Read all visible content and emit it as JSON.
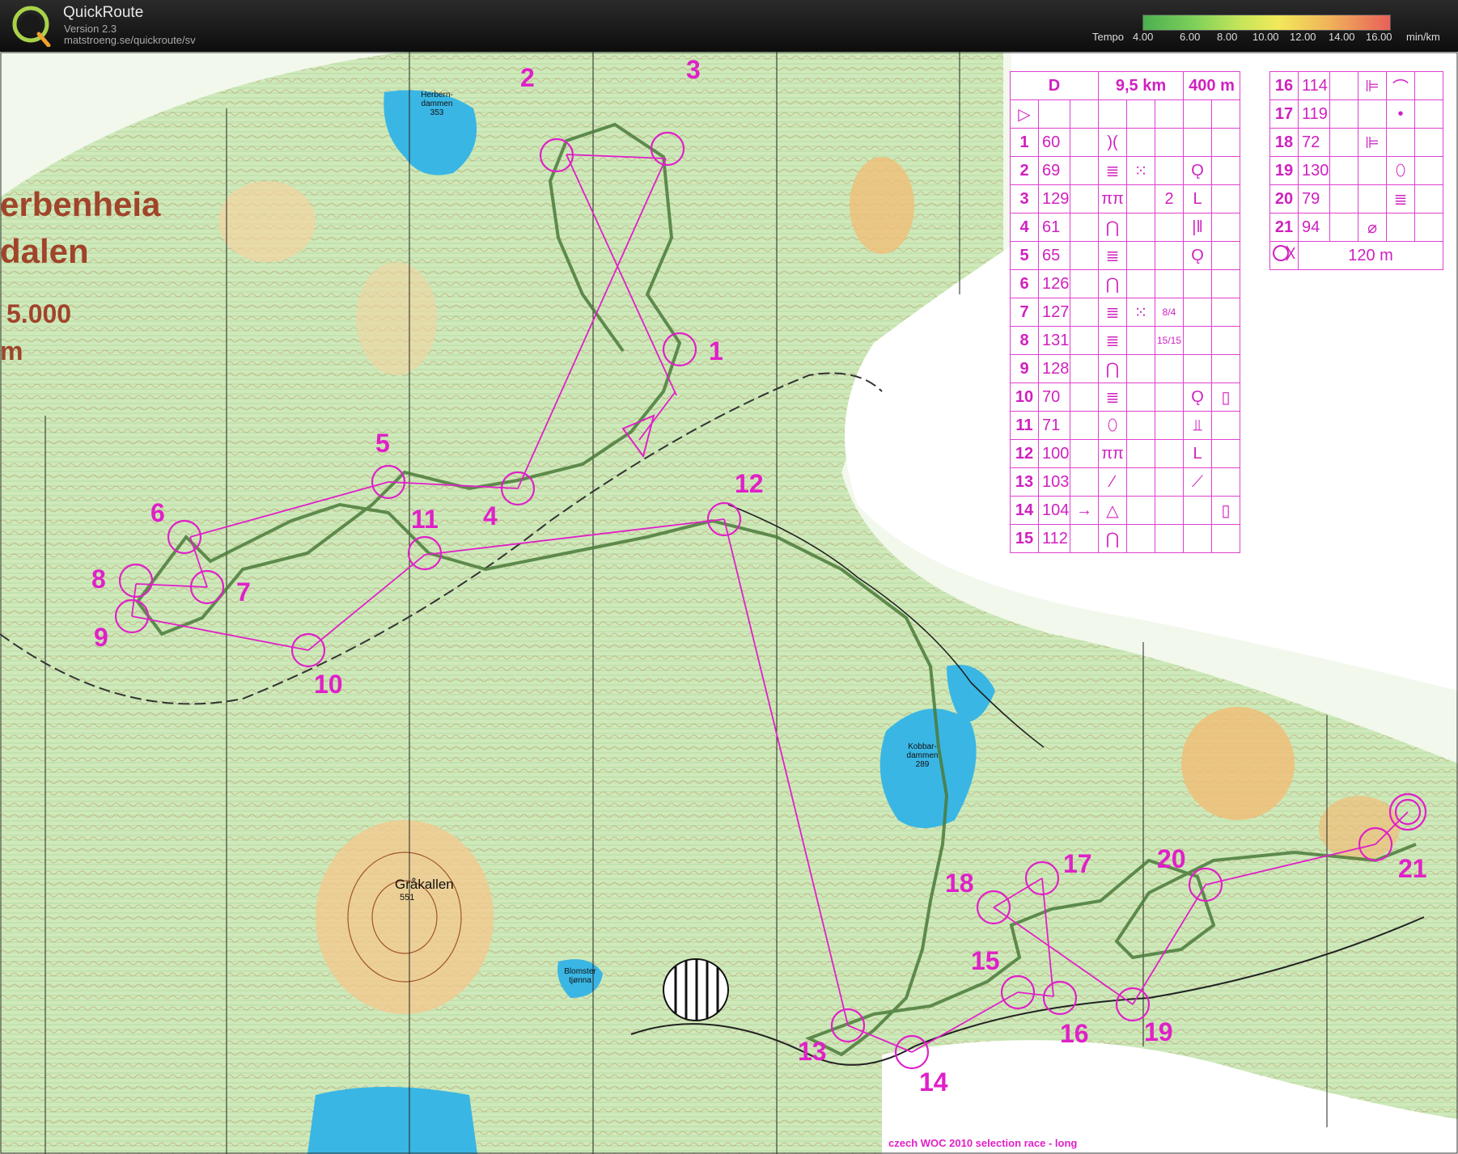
{
  "app": {
    "name": "QuickRoute",
    "version": "Version 2.3",
    "url": "matstroeng.se/quickroute/sv",
    "logo_letter": "Q"
  },
  "tempo": {
    "label": "Tempo",
    "ticks": [
      "4.00",
      "6.00",
      "8.00",
      "10.00",
      "12.00",
      "14.00",
      "16.00"
    ],
    "unit": "min/km"
  },
  "map": {
    "title_line1": "erbenheia",
    "title_line2": "dalen",
    "scale": "5.000",
    "scale_unit": "m",
    "footer": "czech WOC 2010 selection race - long",
    "places": [
      {
        "name": "Gråkallen",
        "height": "551"
      }
    ],
    "lakes": [
      {
        "name1": "Herbern-",
        "name2": "dammen",
        "height": "353"
      },
      {
        "name1": "Kobbar-",
        "name2": "dammen",
        "height": "289"
      },
      {
        "name1": "Blomster",
        "name2": "tjønna",
        "height": ""
      }
    ],
    "controls": [
      "1",
      "2",
      "3",
      "4",
      "5",
      "6",
      "7",
      "8",
      "9",
      "10",
      "11",
      "12",
      "13",
      "14",
      "15",
      "16",
      "17",
      "18",
      "19",
      "20",
      "21"
    ]
  },
  "description": {
    "header": {
      "class": "D",
      "length": "9,5 km",
      "climb": "400 m"
    },
    "start_symbol": "▷",
    "rows": [
      {
        "n": "1",
        "code": "60",
        "c": "",
        "d": ")(",
        "e": "",
        "f": "",
        "g": "",
        "h": ""
      },
      {
        "n": "2",
        "code": "69",
        "c": "",
        "d": "≣",
        "e": "⁙",
        "f": "",
        "g": "Ǫ",
        "h": ""
      },
      {
        "n": "3",
        "code": "129",
        "c": "",
        "d": "ππ",
        "e": "",
        "f": "2",
        "g": "L",
        "h": ""
      },
      {
        "n": "4",
        "code": "61",
        "c": "",
        "d": "⋂",
        "e": "",
        "f": "",
        "g": "|‖",
        "h": ""
      },
      {
        "n": "5",
        "code": "65",
        "c": "",
        "d": "≣",
        "e": "",
        "f": "",
        "g": "Ǫ",
        "h": ""
      },
      {
        "n": "6",
        "code": "126",
        "c": "",
        "d": "⋂",
        "e": "",
        "f": "",
        "g": "",
        "h": ""
      },
      {
        "n": "7",
        "code": "127",
        "c": "",
        "d": "≣",
        "e": "⁙",
        "f": "8/4",
        "g": "",
        "h": ""
      },
      {
        "n": "8",
        "code": "131",
        "c": "",
        "d": "≣",
        "e": "",
        "f": "15/15",
        "g": "",
        "h": ""
      },
      {
        "n": "9",
        "code": "128",
        "c": "",
        "d": "⋂",
        "e": "",
        "f": "",
        "g": "",
        "h": ""
      },
      {
        "n": "10",
        "code": "70",
        "c": "",
        "d": "≣",
        "e": "",
        "f": "",
        "g": "Ǫ",
        "h": "▯"
      },
      {
        "n": "11",
        "code": "71",
        "c": "",
        "d": "⬯",
        "e": "",
        "f": "",
        "g": "⫫",
        "h": ""
      },
      {
        "n": "12",
        "code": "100",
        "c": "",
        "d": "ππ",
        "e": "",
        "f": "",
        "g": "L",
        "h": ""
      },
      {
        "n": "13",
        "code": "103",
        "c": "",
        "d": "⁄",
        "e": "",
        "f": "",
        "g": "⟋",
        "h": ""
      },
      {
        "n": "14",
        "code": "104",
        "c": "→",
        "d": "△",
        "e": "",
        "f": "",
        "g": "",
        "h": "▯"
      },
      {
        "n": "15",
        "code": "112",
        "c": "",
        "d": "⋂",
        "e": "",
        "f": "",
        "g": "",
        "h": ""
      }
    ],
    "rows2": [
      {
        "n": "16",
        "code": "114",
        "d": "⊫",
        "e": "⌒"
      },
      {
        "n": "17",
        "code": "119",
        "d": "",
        "e": "•"
      },
      {
        "n": "18",
        "code": "72",
        "d": "⊫",
        "e": ""
      },
      {
        "n": "19",
        "code": "130",
        "d": "",
        "e": "⬯"
      },
      {
        "n": "20",
        "code": "79",
        "d": "",
        "e": "≣"
      },
      {
        "n": "21",
        "code": "94",
        "d": "⌀",
        "e": ""
      }
    ],
    "finish": "120 m"
  }
}
